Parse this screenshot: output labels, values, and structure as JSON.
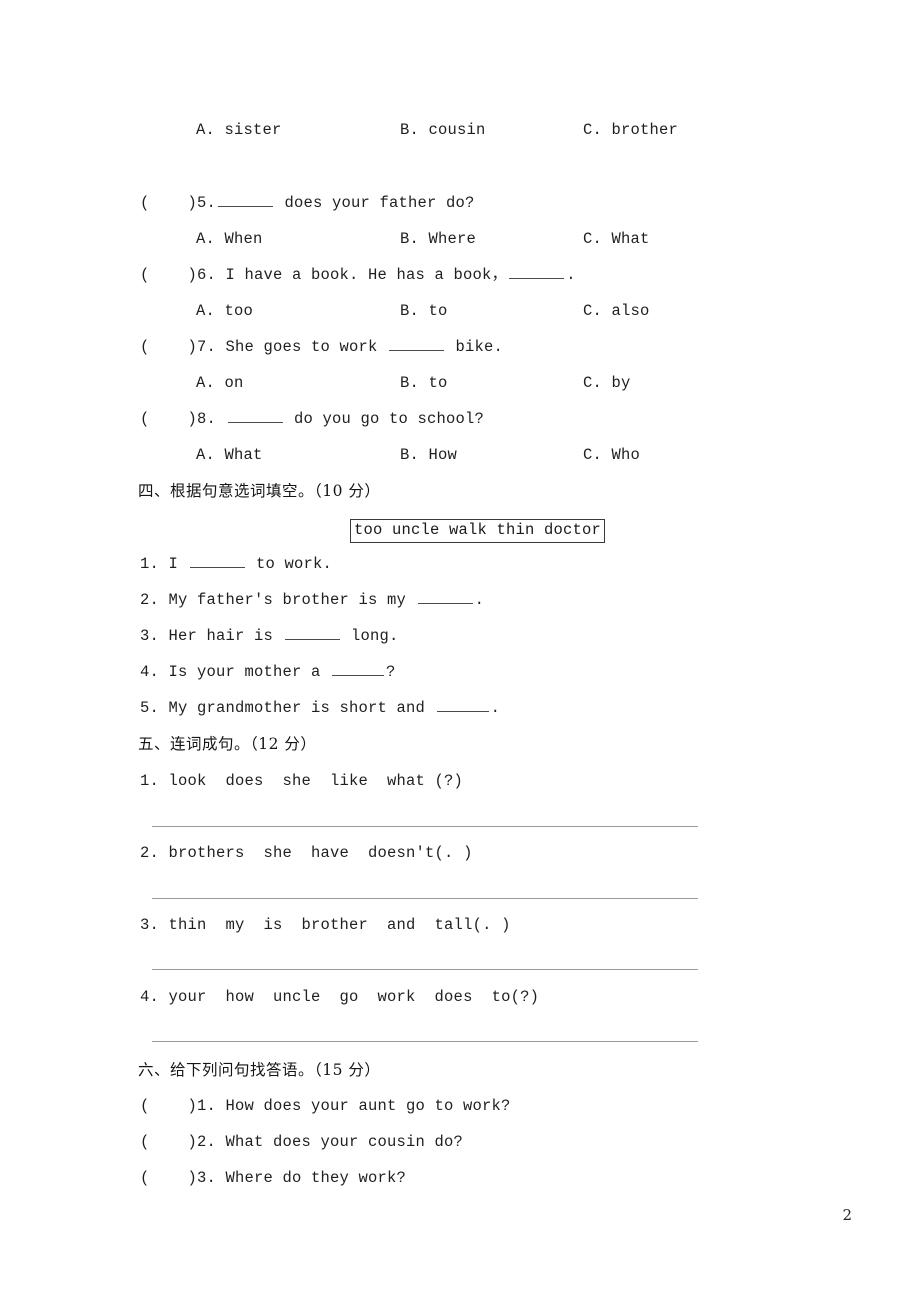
{
  "page": {
    "number": "2",
    "paper_type": "english-exam-worksheet"
  },
  "multiple_choice_carryover": {
    "options_row": {
      "a": "A. sister",
      "b": "B. cousin",
      "c": "C. brother"
    }
  },
  "questions": [
    {
      "marker": "(    )5.",
      "stem_before": "",
      "blank": true,
      "stem_after": " does your father do?",
      "options": {
        "a": "A. When",
        "b": "B. Where",
        "c": "C. What"
      }
    },
    {
      "marker": "(    )6.",
      "stem_before": " I have a book. He has a book，",
      "blank": true,
      "stem_after": ".",
      "options": {
        "a": "A. too",
        "b": "B. to",
        "c": "C. also"
      }
    },
    {
      "marker": "(    )7.",
      "stem_before": " She goes to work ",
      "blank": true,
      "stem_after": " bike.",
      "options": {
        "a": "A. on",
        "b": "B. to",
        "c": "C. by"
      }
    },
    {
      "marker": "(    )8.",
      "stem_before": " ",
      "blank": true,
      "stem_after": " do you go to school?",
      "options": {
        "a": "A. What",
        "b": "B. How",
        "c": "C. Who"
      }
    }
  ],
  "section_four": {
    "heading": "四、根据句意选词填空。（10 分）",
    "word_bank": "too uncle walk thin doctor",
    "items": [
      {
        "number": "1.",
        "before": " I ",
        "after": " to work."
      },
      {
        "number": "2.",
        "before": " My father's brother is my ",
        "after": "."
      },
      {
        "number": "3.",
        "before": " Her hair is ",
        "after": " long."
      },
      {
        "number": "4.",
        "before": " Is your mother a ",
        "after": "?"
      },
      {
        "number": "5.",
        "before": " My grandmother is short and ",
        "after": "."
      }
    ]
  },
  "section_five": {
    "heading": "五、连词成句。（12 分）",
    "items": [
      {
        "number": "1.",
        "text": " look  does  she  like  what (?)"
      },
      {
        "number": "2.",
        "text": " brothers  she  have  doesn't(. )"
      },
      {
        "number": "3.",
        "text": " thin  my  is  brother  and  tall(. )"
      },
      {
        "number": "4.",
        "text": " your  how  uncle  go  work  does  to(?)"
      }
    ]
  },
  "section_six": {
    "heading": "六、给下列问句找答语。（15 分）",
    "items": [
      {
        "marker": "(    )1.",
        "text": " How does your aunt go to work?"
      },
      {
        "marker": "(    )2.",
        "text": " What does your cousin do?"
      },
      {
        "marker": "(    )3.",
        "text": " Where do they work?"
      }
    ]
  }
}
